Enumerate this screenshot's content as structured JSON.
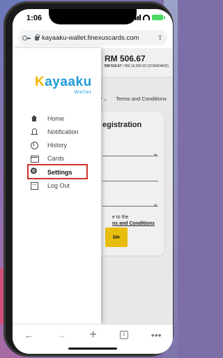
{
  "status_bar": {
    "time": "1:06"
  },
  "browser": {
    "url": "kayaaku-wallet.finexuscards.com",
    "tab_count": "1"
  },
  "header": {
    "balance": "RM 506.67",
    "balance_sub_bold": "RM 516.67",
    "balance_sub_rest": " / RM 10,000.00 (STANDARD)"
  },
  "nav": {
    "item1": "rity ⌄",
    "item2": "Terms and Conditions"
  },
  "card": {
    "title": "egistration",
    "agree_prefix": "e to the",
    "agree_link": "ns and Conditions",
    "button_label": "ble"
  },
  "logo": {
    "main_k": "K",
    "main_rest": "ayaaku",
    "sub": "Wallet"
  },
  "menu": {
    "items": [
      {
        "label": "Home",
        "icon": "home-icon"
      },
      {
        "label": "Notification",
        "icon": "bell-icon"
      },
      {
        "label": "History",
        "icon": "history-icon"
      },
      {
        "label": "Cards",
        "icon": "cards-icon"
      },
      {
        "label": "Settings",
        "icon": "gear-icon"
      },
      {
        "label": "Log Out",
        "icon": "logout-icon"
      }
    ],
    "highlighted": "Settings"
  },
  "colors": {
    "brand_blue": "#1e9ad6",
    "brand_yellow": "#f4b400",
    "button_yellow": "#f8c90f",
    "highlight_red": "#d0312d"
  }
}
